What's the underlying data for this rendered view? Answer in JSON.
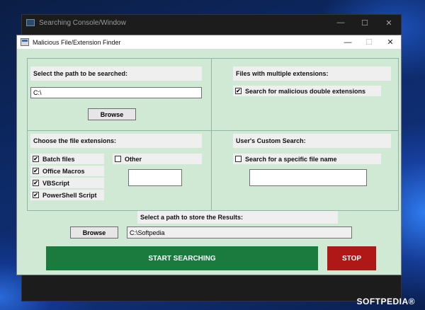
{
  "console": {
    "title": "Searching Console/Window",
    "controls": [
      "—",
      "☐",
      "✕"
    ]
  },
  "dialog": {
    "title": "Malicious File/Extension Finder",
    "controls": {
      "minimize": "—",
      "maximize": "☐",
      "close": "✕"
    }
  },
  "path_section": {
    "label": "Select the path to be searched:",
    "path_value": "C:\\",
    "browse_label": "Browse"
  },
  "multi_ext_section": {
    "label": "Files with multiple extensions:",
    "checkbox": {
      "label": "Search for malicious double extensions",
      "checked": true
    }
  },
  "extensions_section": {
    "label": "Choose the file extensions:",
    "items": [
      {
        "label": "Batch files",
        "checked": true
      },
      {
        "label": "Office Macros",
        "checked": true
      },
      {
        "label": "VBScript",
        "checked": true
      },
      {
        "label": "PowerShell Script",
        "checked": true
      }
    ],
    "other": {
      "label": "Other",
      "checked": false,
      "value": ""
    }
  },
  "custom_section": {
    "label": "User's Custom Search:",
    "checkbox": {
      "label": "Search for a specific file name",
      "checked": false
    },
    "value": ""
  },
  "results": {
    "label": "Select a path to store the Results:",
    "browse_label": "Browse",
    "path_value": "C:\\Softpedia"
  },
  "actions": {
    "start_label": "START SEARCHING",
    "stop_label": "STOP",
    "start_color": "#1b7a3e",
    "stop_color": "#b01818"
  },
  "watermark": "SOFTPEDIA®"
}
